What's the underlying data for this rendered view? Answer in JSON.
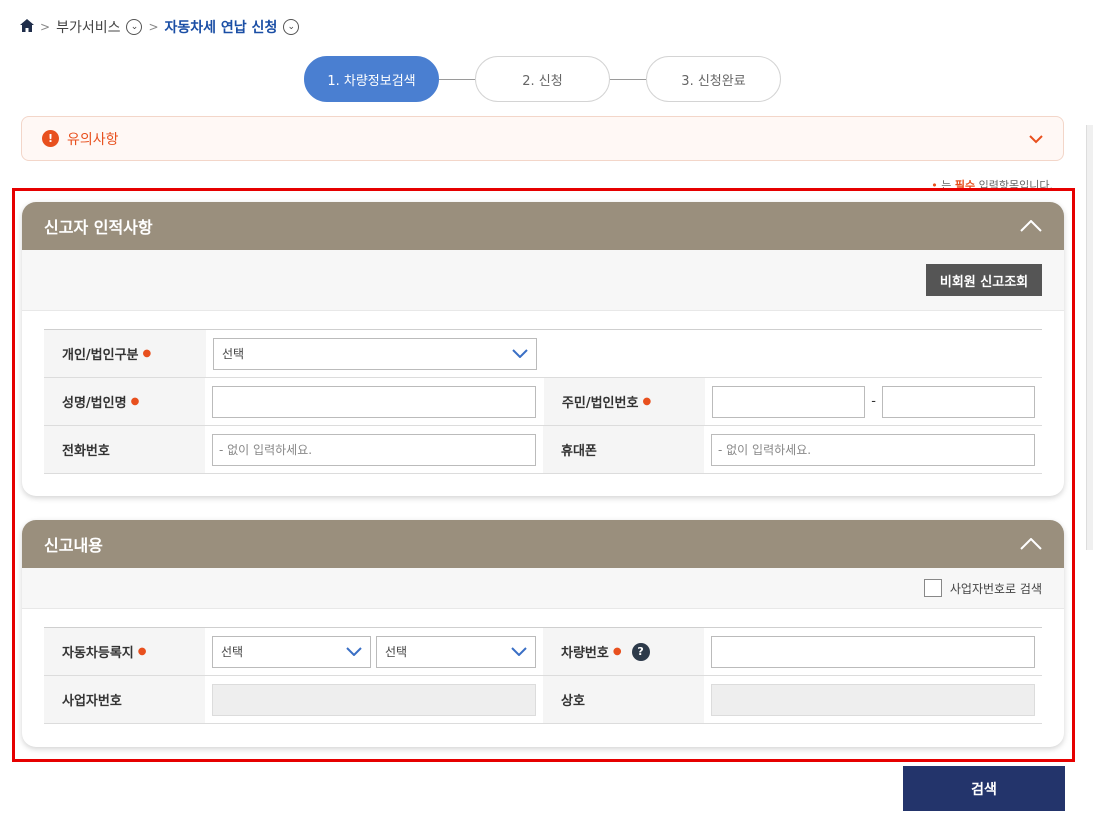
{
  "breadcrumb": {
    "home_icon": "home-icon",
    "items": [
      "부가서비스",
      "자동차세 연납 신청"
    ]
  },
  "steps": [
    {
      "label": "1. 차량정보검색",
      "active": true
    },
    {
      "label": "2. 신청",
      "active": false
    },
    {
      "label": "3. 신청완료",
      "active": false
    }
  ],
  "notice": {
    "label": "유의사항"
  },
  "required_note": {
    "prefix": "는 ",
    "bold": "필수",
    "suffix": " 입력항목입니다."
  },
  "section1": {
    "title": "신고자 인적사항",
    "lookup_button": "비회원 신고조회",
    "fields": {
      "type_label": "개인/법인구분",
      "type_value": "선택",
      "name_label": "성명/법인명",
      "id_label": "주민/법인번호",
      "id_separator": "-",
      "phone_label": "전화번호",
      "phone_placeholder": "- 없이 입력하세요.",
      "mobile_label": "휴대폰",
      "mobile_placeholder": "- 없이 입력하세요."
    }
  },
  "section2": {
    "title": "신고내용",
    "checkbox_label": "사업자번호로 검색",
    "fields": {
      "region_label": "자동차등록지",
      "region_value1": "선택",
      "region_value2": "선택",
      "car_no_label": "차량번호",
      "biz_no_label": "사업자번호",
      "company_label": "상호"
    }
  },
  "search_button": "검색",
  "colors": {
    "accent": "#4a7fd1",
    "header": "#9a8f7d",
    "primary_btn": "#23346b",
    "required": "#e8501e",
    "highlight": "#e60000"
  }
}
